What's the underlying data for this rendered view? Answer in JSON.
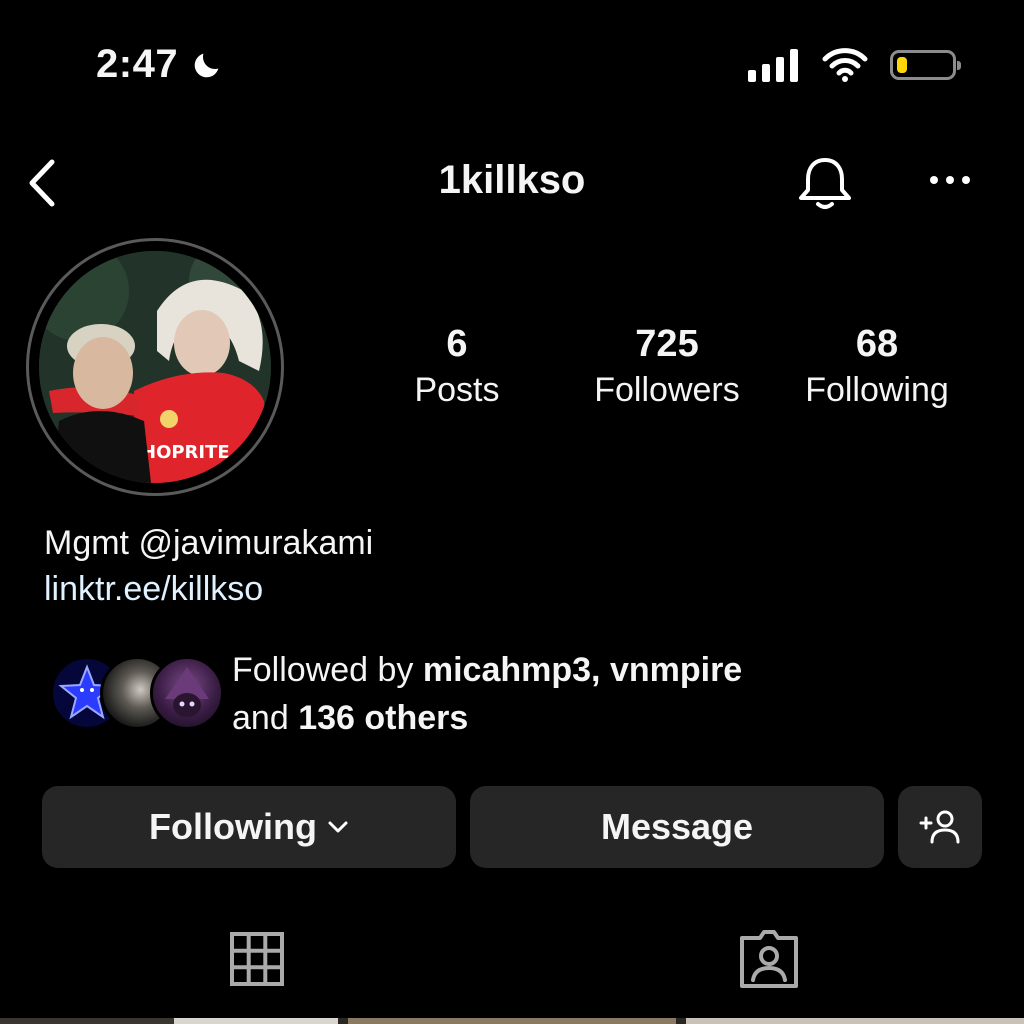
{
  "status_bar": {
    "time": "2:47",
    "battery_level": 0.18
  },
  "header": {
    "username": "1killkso"
  },
  "stats": [
    {
      "value": "6",
      "label": "Posts"
    },
    {
      "value": "725",
      "label": "Followers"
    },
    {
      "value": "68",
      "label": "Following"
    }
  ],
  "bio": {
    "line1": "Mgmt @javimurakami",
    "link": "linktr.ee/killkso"
  },
  "followed_by": {
    "prefix": "Followed by ",
    "names": "micahmp3, vnmpire",
    "and": "and ",
    "others": "136 others"
  },
  "buttons": {
    "following": "Following",
    "message": "Message"
  },
  "avatar_shirt_text": "HOPRITE",
  "icons": {
    "back": "chevron-left-icon",
    "bell": "bell-icon",
    "more": "more-horizontal-icon",
    "chevron": "chevron-down-icon",
    "add_person": "add-person-icon",
    "grid": "grid-icon",
    "tagged": "tagged-person-icon"
  },
  "colors": {
    "background": "#000000",
    "button": "#262626",
    "battery": "#ffd60a",
    "link": "#e0f1ff"
  }
}
